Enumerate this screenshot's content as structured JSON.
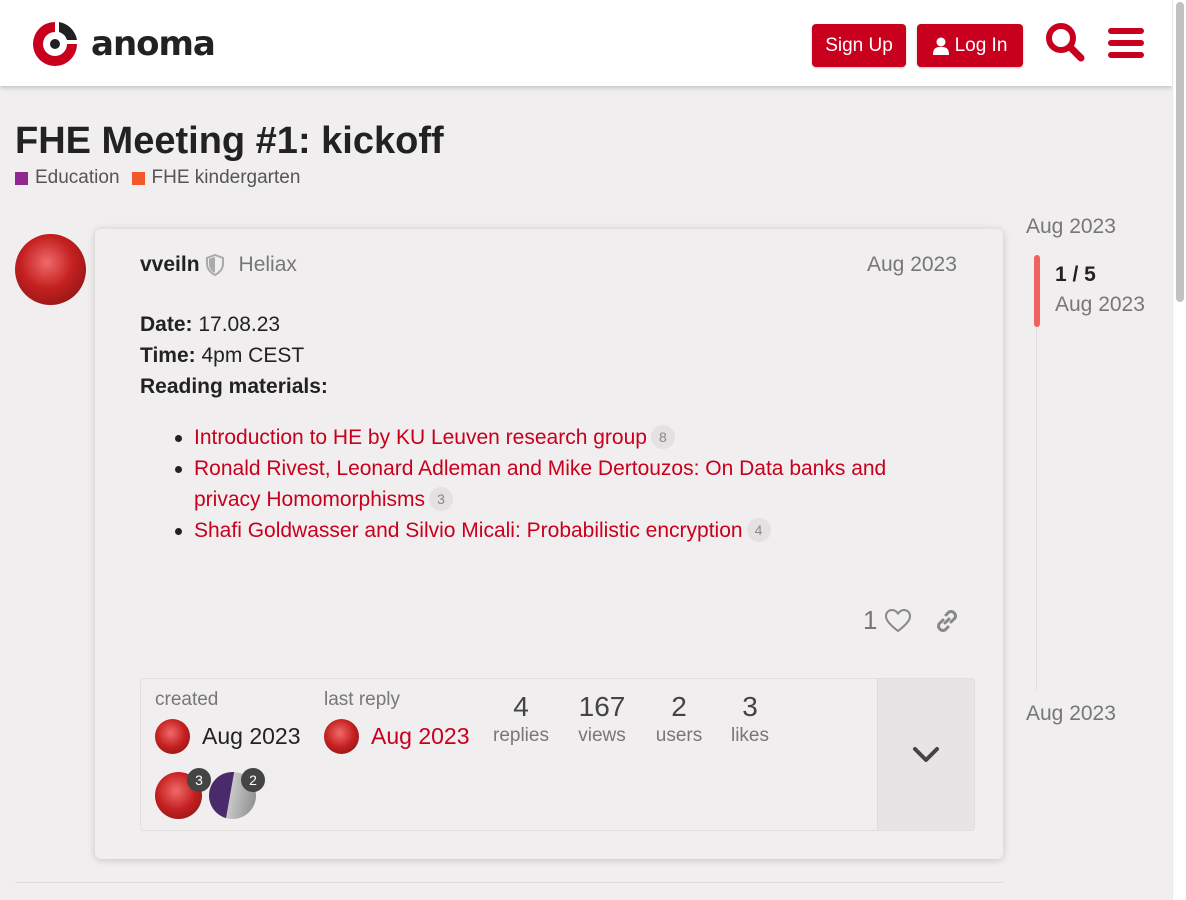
{
  "header": {
    "logo_text": "anoma",
    "signup_label": "Sign Up",
    "login_label": "Log In",
    "accent": "#c8001e"
  },
  "topic": {
    "title": "FHE Meeting #1: kickoff",
    "categories": [
      {
        "label": "Education",
        "color": "#92278f"
      },
      {
        "label": "FHE kindergarten",
        "color": "#f1592a"
      }
    ]
  },
  "post": {
    "username": "vveiln",
    "group": "Heliax",
    "date": "Aug 2023",
    "date_label": "Date:",
    "date_value": "17.08.23",
    "time_label": "Time:",
    "time_value": "4pm CEST",
    "reading_label": "Reading materials:",
    "links": [
      {
        "text": "Introduction to HE by KU Leuven research group",
        "clicks": "8"
      },
      {
        "text": "Ronald Rivest, Leonard Adleman and Mike Dertouzos: On Data banks and privacy Homomorphisms",
        "clicks": "3"
      },
      {
        "text": "Shafi Goldwasser and Silvio Micali: Probabilistic encryption",
        "clicks": "4"
      }
    ],
    "likes": "1"
  },
  "topic_map": {
    "created_label": "created",
    "created_date": "Aug 2023",
    "last_reply_label": "last reply",
    "last_reply_date": "Aug 2023",
    "stats": [
      {
        "num": "4",
        "label": "replies"
      },
      {
        "num": "167",
        "label": "views"
      },
      {
        "num": "2",
        "label": "users"
      },
      {
        "num": "3",
        "label": "likes"
      }
    ],
    "participants": [
      {
        "count": "3"
      },
      {
        "count": "2"
      }
    ]
  },
  "timeline": {
    "top_date": "Aug 2023",
    "position": "1 / 5",
    "position_date": "Aug 2023",
    "bottom_date": "Aug 2023"
  }
}
